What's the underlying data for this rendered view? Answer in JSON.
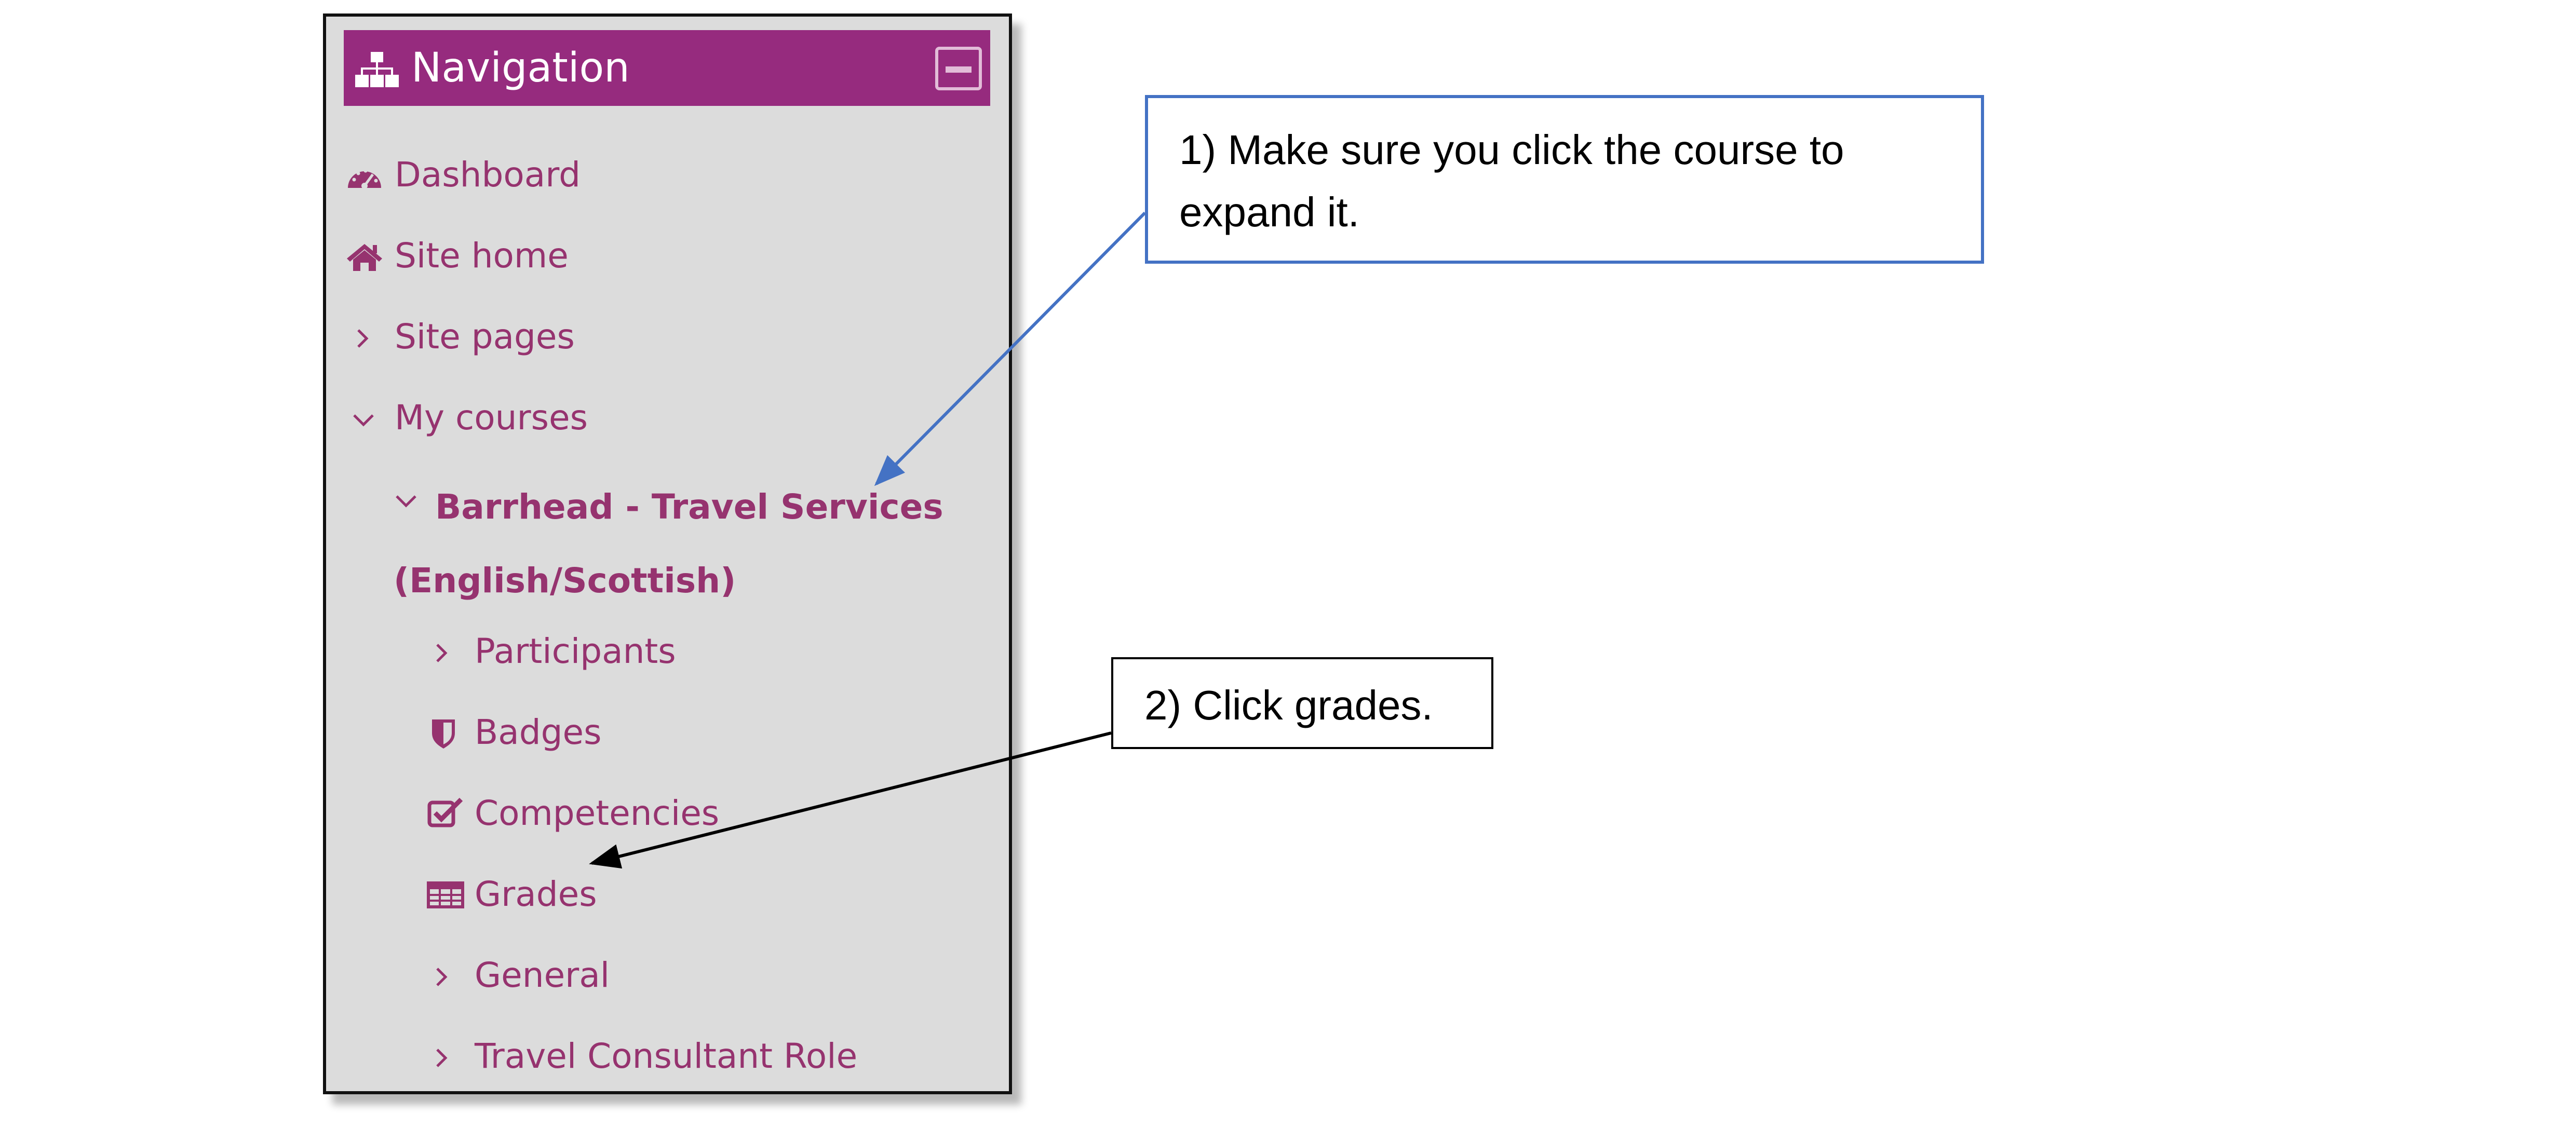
{
  "navigation": {
    "title": "Navigation",
    "items": [
      {
        "label": "Dashboard",
        "icon": "dashboard-icon"
      },
      {
        "label": "Site home",
        "icon": "home-icon"
      },
      {
        "label": "Site pages",
        "icon": "chevron-right-icon"
      },
      {
        "label": "My courses",
        "icon": "chevron-down-icon"
      }
    ],
    "course": {
      "label": "Barrhead - Travel Services (English/Scottish)",
      "icon": "chevron-down-icon"
    },
    "course_items": [
      {
        "label": "Participants",
        "icon": "chevron-right-icon"
      },
      {
        "label": "Badges",
        "icon": "shield-icon"
      },
      {
        "label": "Competencies",
        "icon": "checkbox-icon"
      },
      {
        "label": "Grades",
        "icon": "table-icon"
      },
      {
        "label": "General",
        "icon": "chevron-right-icon"
      },
      {
        "label": "Travel Consultant Role",
        "icon": "chevron-right-icon"
      }
    ]
  },
  "annotations": {
    "step1": "1) Make sure you click the course to expand it.",
    "step2": "2) Click grades."
  },
  "colors": {
    "header_bg": "#962b7e",
    "panel_bg": "#dcdcdc",
    "link": "#96336f",
    "callout1_border": "#4472c4",
    "callout2_border": "#000000"
  }
}
